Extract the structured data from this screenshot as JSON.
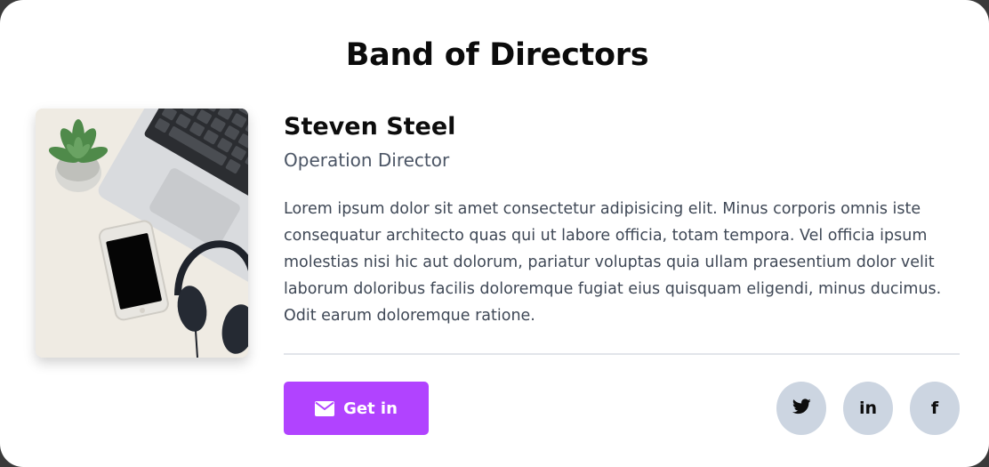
{
  "section": {
    "title": "Band of Directors"
  },
  "member": {
    "name": "Steven Steel",
    "role": "Operation Director",
    "bio": "Lorem ipsum dolor sit amet consectetur adipisicing elit. Minus corporis omnis iste consequatur architecto quas qui ut labore officia, totam tempora. Vel officia ipsum molestias nisi hic aut dolorum, pariatur voluptas quia ullam praesentium dolor velit laborum doloribus facilis doloremque fugiat eius quisquam eligendi, minus ducimus. Odit earum doloremque ratione.",
    "photo_icon": "desk-photo"
  },
  "actions": {
    "contact_label": "Get in",
    "contact_icon": "envelope-icon"
  },
  "social": [
    {
      "icon": "twitter-icon",
      "glyph": ""
    },
    {
      "icon": "linkedin-icon",
      "glyph": "in"
    },
    {
      "icon": "facebook-icon",
      "glyph": "f"
    }
  ],
  "colors": {
    "accent": "#b143ff",
    "social_bg": "#ccd5e1",
    "text_muted": "#4b5565"
  }
}
